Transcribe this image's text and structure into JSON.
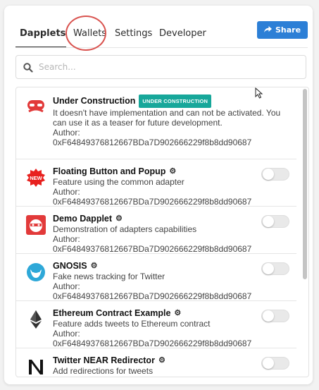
{
  "tabs": [
    {
      "label": "Dapplets"
    },
    {
      "label": "Wallets"
    },
    {
      "label": "Settings"
    },
    {
      "label": "Developer"
    }
  ],
  "share": {
    "label": "Share",
    "icon": "share-icon"
  },
  "search": {
    "placeholder": "Search...",
    "value": ""
  },
  "colors": {
    "accent": "#2c7fd6",
    "badge": "#17a79a",
    "highlight": "#d9534f"
  },
  "dapplets": [
    {
      "title": "Under Construction",
      "badge": "UNDER CONSTRUCTION",
      "description": "It doesn't have implementation and can not be activated. You can use it as a teaser for future development.",
      "author_label": "Author:",
      "author": "0xF64849376812667BDa7D902666229f8b8dd90687",
      "icon": "under-construction-icon"
    },
    {
      "title": "Floating Button and Popup",
      "description": "Feature using the common adapter",
      "author_label": "Author:",
      "author": "0xF64849376812667BDa7D902666229f8b8dd90687",
      "icon": "new-badge-icon",
      "enabled": false
    },
    {
      "title": "Demo Dapplet",
      "description": "Demonstration of adapters capabilities",
      "author_label": "Author:",
      "author": "0xF64849376812667BDa7D902666229f8b8dd90687",
      "icon": "demo-dapplet-icon",
      "enabled": false
    },
    {
      "title": "GNOSIS",
      "description": "Fake news tracking for Twitter",
      "author_label": "Author:",
      "author": "0xF64849376812667BDa7D902666229f8b8dd90687",
      "icon": "gnosis-owl-icon",
      "enabled": false
    },
    {
      "title": "Ethereum Contract Example",
      "description": "Feature adds tweets to Ethereum contract",
      "author_label": "Author:",
      "author": "0xF64849376812667BDa7D902666229f8b8dd90687",
      "icon": "ethereum-icon",
      "enabled": false
    },
    {
      "title": "Twitter NEAR Redirector",
      "description": "Add redirections for tweets",
      "icon": "near-icon",
      "enabled": false
    }
  ]
}
